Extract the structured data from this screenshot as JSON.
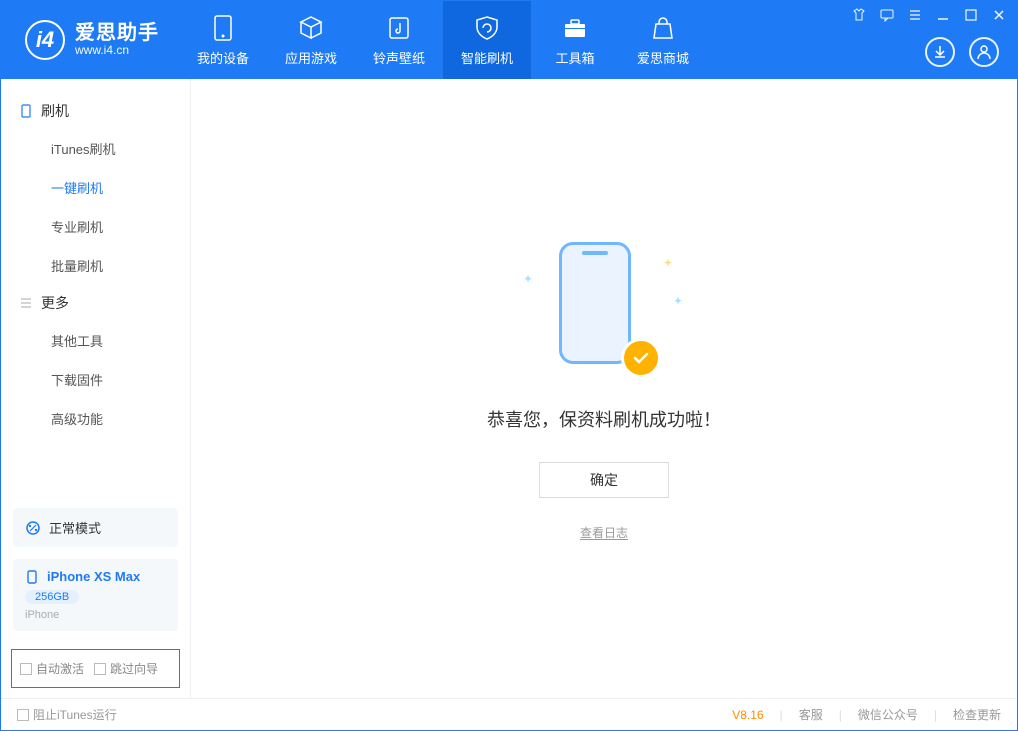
{
  "app": {
    "title": "爱思助手",
    "subtitle": "www.i4.cn"
  },
  "nav": {
    "items": [
      {
        "label": "我的设备"
      },
      {
        "label": "应用游戏"
      },
      {
        "label": "铃声壁纸"
      },
      {
        "label": "智能刷机"
      },
      {
        "label": "工具箱"
      },
      {
        "label": "爱思商城"
      }
    ],
    "active_index": 3
  },
  "sidebar": {
    "cat1": "刷机",
    "cat1_items": [
      "iTunes刷机",
      "一键刷机",
      "专业刷机",
      "批量刷机"
    ],
    "cat1_active_index": 1,
    "cat2": "更多",
    "cat2_items": [
      "其他工具",
      "下载固件",
      "高级功能"
    ],
    "status": "正常模式",
    "device": {
      "name": "iPhone XS Max",
      "capacity": "256GB",
      "type": "iPhone"
    },
    "opts": {
      "auto_activate": "自动激活",
      "skip_guide": "跳过向导"
    }
  },
  "main": {
    "success_text": "恭喜您，保资料刷机成功啦！",
    "ok_label": "确定",
    "log_link": "查看日志"
  },
  "footer": {
    "block_itunes": "阻止iTunes运行",
    "version": "V8.16",
    "links": [
      "客服",
      "微信公众号",
      "检查更新"
    ]
  }
}
